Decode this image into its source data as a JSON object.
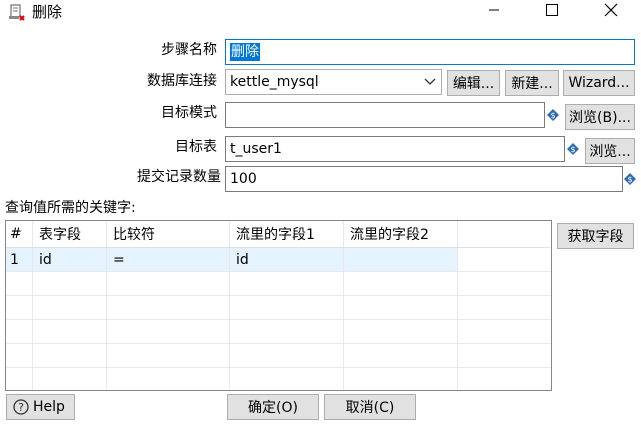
{
  "window": {
    "title": "删除",
    "icon": "delete-step-icon",
    "controls": [
      "minimize",
      "maximize",
      "close"
    ]
  },
  "form": {
    "step_name_label": "步骤名称",
    "step_name_value": "删除",
    "connection_label": "数据库连接",
    "connection_value": "kettle_mysql",
    "edit_button": "编辑...",
    "new_button": "新建...",
    "wizard_button": "Wizard...",
    "target_schema_label": "目标模式",
    "target_schema_value": "",
    "browse_schema_button": "浏览(B)...",
    "target_table_label": "目标表",
    "target_table_value": "t_user1",
    "browse_table_button": "浏览...",
    "commit_size_label": "提交记录数量",
    "commit_size_value": "100",
    "keys_label": "查询值所需的关键字:",
    "get_fields_button": "获取字段"
  },
  "grid": {
    "columns": [
      "#",
      "表字段",
      "比较符",
      "流里的字段1",
      "流里的字段2"
    ],
    "rows": [
      [
        "1",
        "id",
        "=",
        "id",
        ""
      ]
    ]
  },
  "footer": {
    "help_button": "Help",
    "ok_button": "确定(O)",
    "cancel_button": "取消(C)"
  },
  "colors": {
    "selection": "#0078d7",
    "row_highlight": "#e5f3ff",
    "button_bg": "#e1e1e1"
  }
}
